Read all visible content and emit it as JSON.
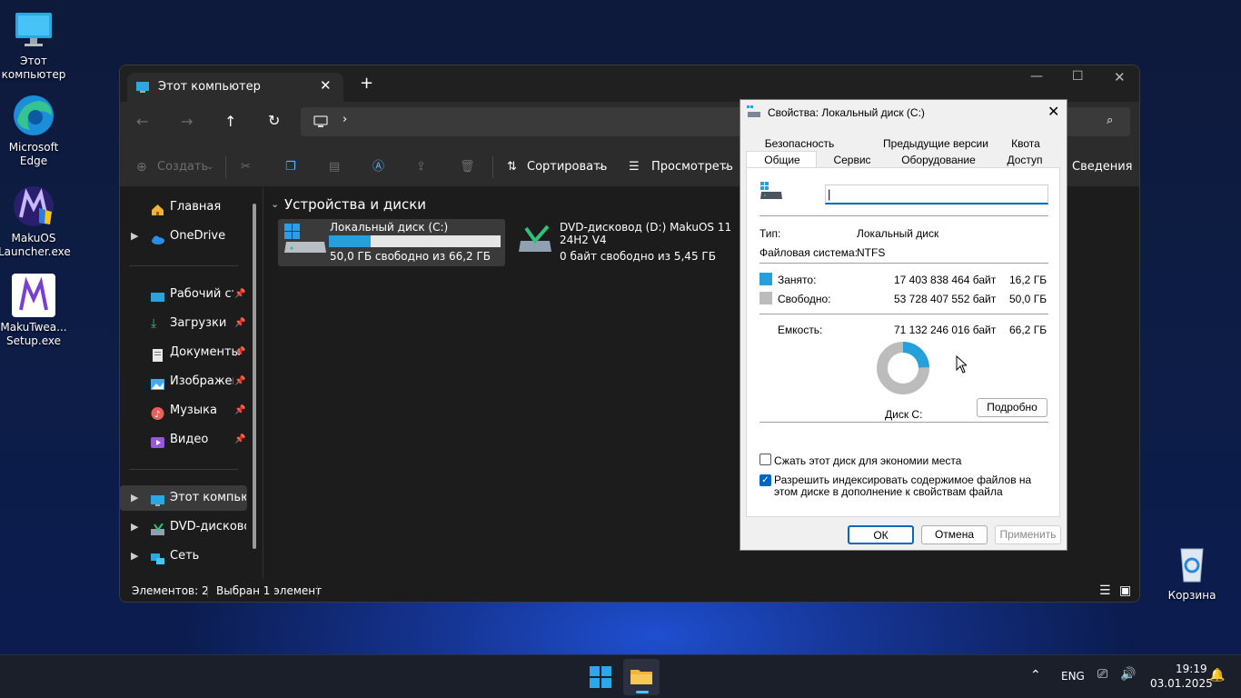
{
  "desktop": {
    "icons": [
      {
        "label": "Этот компьютер"
      },
      {
        "label": "Microsoft Edge"
      },
      {
        "label": "MakuOS Launcher.exe"
      },
      {
        "label": "MakuTwea... Setup.exe"
      }
    ],
    "recycle": "Корзина"
  },
  "explorer": {
    "tab_title": "Этот компьютер",
    "toolbar": {
      "create": "Создать",
      "sort": "Сортировать",
      "view": "Просмотреть",
      "details": "Сведения"
    },
    "section_title": "Устройства и диски",
    "drives": [
      {
        "name": "Локальный диск (C:)",
        "free_text": "50,0 ГБ свободно из 66,2 ГБ",
        "used_fraction": 0.245
      },
      {
        "name": "DVD-дисковод (D:) MakuOS 11 24H2 V4",
        "free_text": "0 байт свободно из 5,45 ГБ"
      }
    ],
    "nav": {
      "home": "Главная",
      "onedrive": "OneDrive",
      "desktop": "Рабочий стол",
      "downloads": "Загрузки",
      "documents": "Документы",
      "pictures": "Изображения",
      "music": "Музыка",
      "videos": "Видео",
      "thispc": "Этот компьютер",
      "dvd": "DVD-дисковод (D:)",
      "network": "Сеть"
    },
    "status": {
      "count": "Элементов: 2",
      "selected": "Выбран 1 элемент"
    }
  },
  "dialog": {
    "title": "Свойства: Локальный диск (C:)",
    "tabs_row1": [
      "Безопасность",
      "Предыдущие версии",
      "Квота"
    ],
    "tabs_row2": [
      "Общие",
      "Сервис",
      "Оборудование",
      "Доступ"
    ],
    "name_value": "",
    "type_label": "Тип:",
    "type_value": "Локальный диск",
    "fs_label": "Файловая система:",
    "fs_value": "NTFS",
    "used_label": "Занято:",
    "used_bytes": "17 403 838 464 байт",
    "used_gb": "16,2 ГБ",
    "free_label": "Свободно:",
    "free_bytes": "53 728 407 552 байт",
    "free_gb": "50,0 ГБ",
    "cap_label": "Емкость:",
    "cap_bytes": "71 132 246 016 байт",
    "cap_gb": "66,2 ГБ",
    "used_fraction": 0.245,
    "disk_label": "Диск C:",
    "details_btn": "Подробно",
    "compress_label": "Сжать этот диск для экономии места",
    "compress_checked": false,
    "index_label": "Разрешить индексировать содержимое файлов на этом диске в дополнение к свойствам файла",
    "index_checked": true,
    "ok": "ОК",
    "cancel": "Отмена",
    "apply": "Применить",
    "colors": {
      "used": "#26a0da",
      "free": "#bcbcbc"
    }
  },
  "taskbar": {
    "lang": "ENG",
    "time": "19:19",
    "date": "03.01.2025"
  }
}
